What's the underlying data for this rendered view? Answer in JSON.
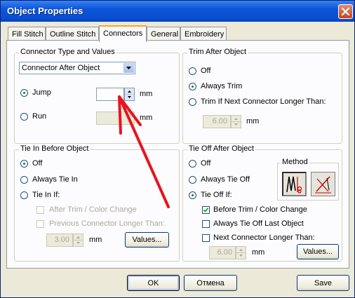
{
  "window": {
    "title": "Object Properties"
  },
  "tabs": [
    {
      "label": "Fill Stitch"
    },
    {
      "label": "Outline Stitch"
    },
    {
      "label": "Connectors"
    },
    {
      "label": "General"
    },
    {
      "label": "Embroidery"
    }
  ],
  "active_tab": "Connectors",
  "connector_group": {
    "legend": "Connector Type and Values",
    "type_select_value": "Connector After Object",
    "jump_label": "Jump",
    "jump_value": "",
    "jump_unit": "mm",
    "jump_selected": true,
    "run_label": "Run",
    "run_value": "",
    "run_unit": "mm"
  },
  "trim_group": {
    "legend": "Trim After Object",
    "off_label": "Off",
    "always_trim_label": "Always Trim",
    "selected": "Always Trim",
    "trim_if_label": "Trim If Next Connector Longer Than:",
    "trim_value": "6.00",
    "trim_unit": "mm"
  },
  "tiein_group": {
    "legend": "Tie In Before Object",
    "off_label": "Off",
    "selected": "Off",
    "always_label": "Always Tie In",
    "if_label": "Tie In If:",
    "after_trim_label": "After Trim / Color Change",
    "prev_conn_label": "Previous Connector Longer Than:",
    "value": "3.00",
    "unit": "mm",
    "values_button": "Values..."
  },
  "tieoff_group": {
    "legend": "Tie Off After Object",
    "off_label": "Off",
    "always_label": "Always Tie Off",
    "if_label": "Tie Off If:",
    "selected": "Tie Off If:",
    "before_trim_label": "Before Trim / Color Change",
    "before_trim_checked": true,
    "always_last_label": "Always Tie Off Last Object",
    "next_conn_label": "Next Connector Longer Than:",
    "value": "6.00",
    "unit": "mm",
    "values_button": "Values...",
    "method_legend": "Method"
  },
  "footer": {
    "ok_label": "OK",
    "cancel_label": "Отмена",
    "save_label": "Save"
  },
  "colors": {
    "title_bar": "#0a55d8",
    "annotation_arrow": "#e8141e"
  }
}
